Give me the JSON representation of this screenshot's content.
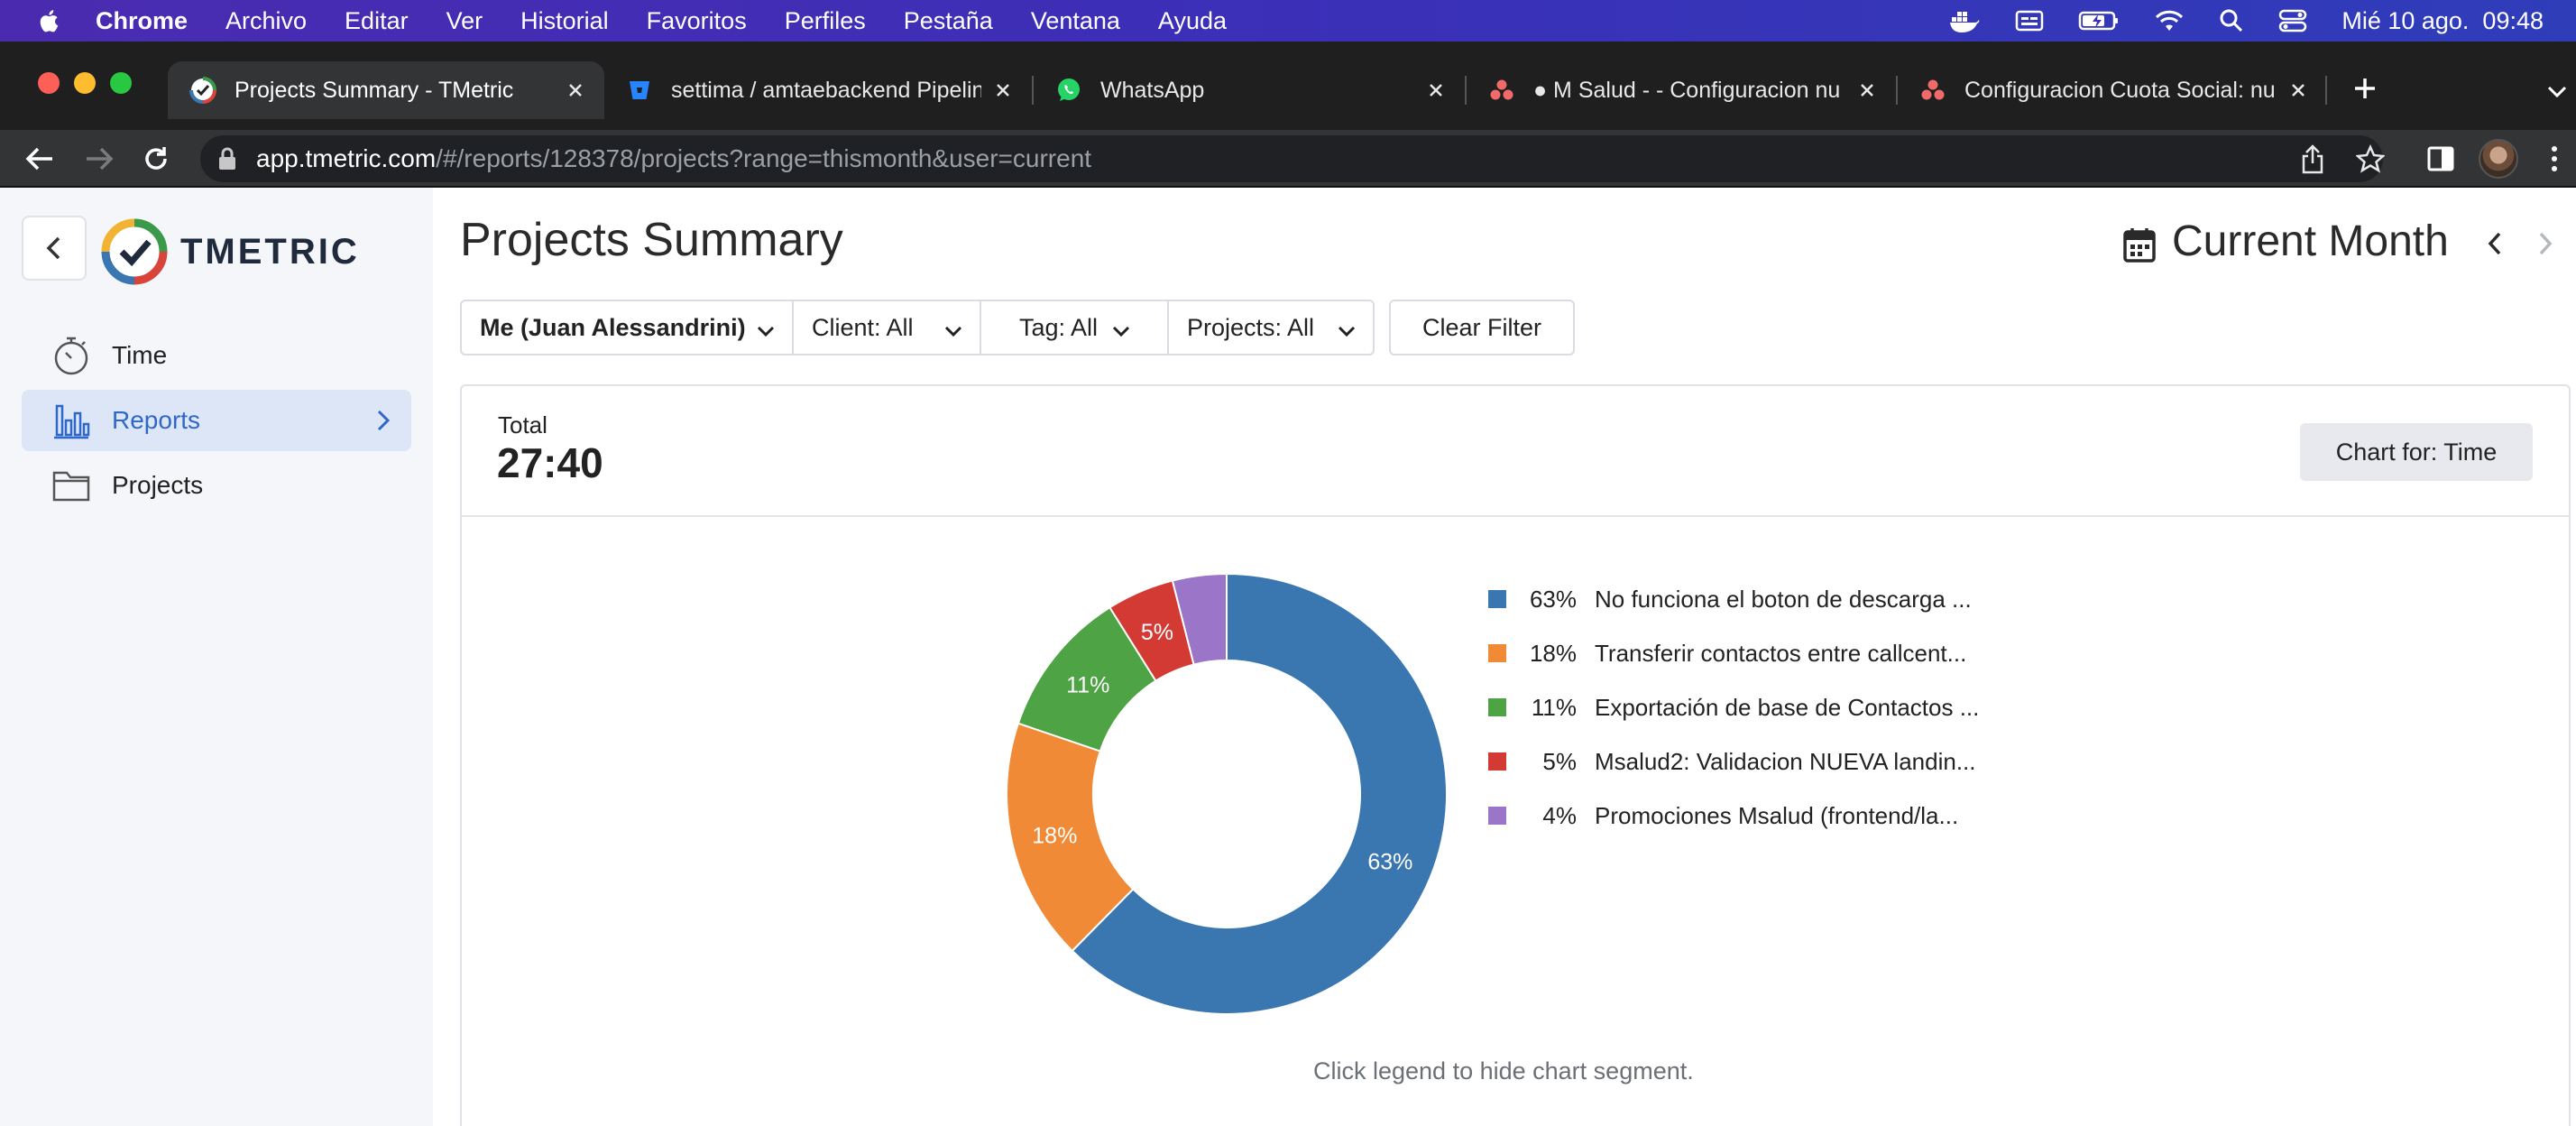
{
  "menubar": {
    "app": "Chrome",
    "items": [
      "Archivo",
      "Editar",
      "Ver",
      "Historial",
      "Favoritos",
      "Perfiles",
      "Pestaña",
      "Ventana",
      "Ayuda"
    ],
    "clock": "Mié 10 ago.  09:48"
  },
  "tabs": [
    {
      "title": "Projects Summary - TMetric",
      "icon": "tmetric-icon",
      "active": true
    },
    {
      "title": "settima / amtaebackend Pipelin",
      "icon": "bitbucket-icon"
    },
    {
      "title": "WhatsApp",
      "icon": "whatsapp-icon"
    },
    {
      "title": "● M Salud - - Configuracion nu",
      "icon": "asana-icon"
    },
    {
      "title": "Configuracion Cuota Social: nu",
      "icon": "asana-icon"
    }
  ],
  "address_bar": {
    "domain": "app.tmetric.com",
    "path": "/#/reports/128378/projects?range=thismonth&user=current"
  },
  "sidebar": {
    "brand": "TMETRIC",
    "items": [
      {
        "label": "Time",
        "icon": "stopwatch-icon"
      },
      {
        "label": "Reports",
        "icon": "bar-chart-icon",
        "active": true
      },
      {
        "label": "Projects",
        "icon": "folder-icon"
      }
    ]
  },
  "page": {
    "title": "Projects Summary",
    "period": "Current Month"
  },
  "filters": {
    "user": "Me (Juan Alessandrini)",
    "client": "Client: All",
    "tag": "Tag: All",
    "projects": "Projects: All",
    "clear": "Clear Filter"
  },
  "summary": {
    "total_label": "Total",
    "total_value": "27:40",
    "chart_for": "Chart for: Time"
  },
  "chart_data": {
    "type": "pie",
    "donut": true,
    "categories": [
      "No funciona el boton de descarga ...",
      "Transferir contactos entre callcent...",
      "Exportación de base de Contactos ...",
      "Msalud2: Validacion NUEVA landin...",
      "Promociones Msalud (frontend/la..."
    ],
    "values": [
      63,
      18,
      11,
      5,
      4
    ],
    "labels": [
      "63%",
      "18%",
      "11%",
      "5%",
      "4%"
    ],
    "colors": [
      "#3a76b0",
      "#f18a36",
      "#4ea345",
      "#d43a34",
      "#9a75c8"
    ],
    "legend_position": "right"
  },
  "hint": "Click legend to hide chart segment."
}
